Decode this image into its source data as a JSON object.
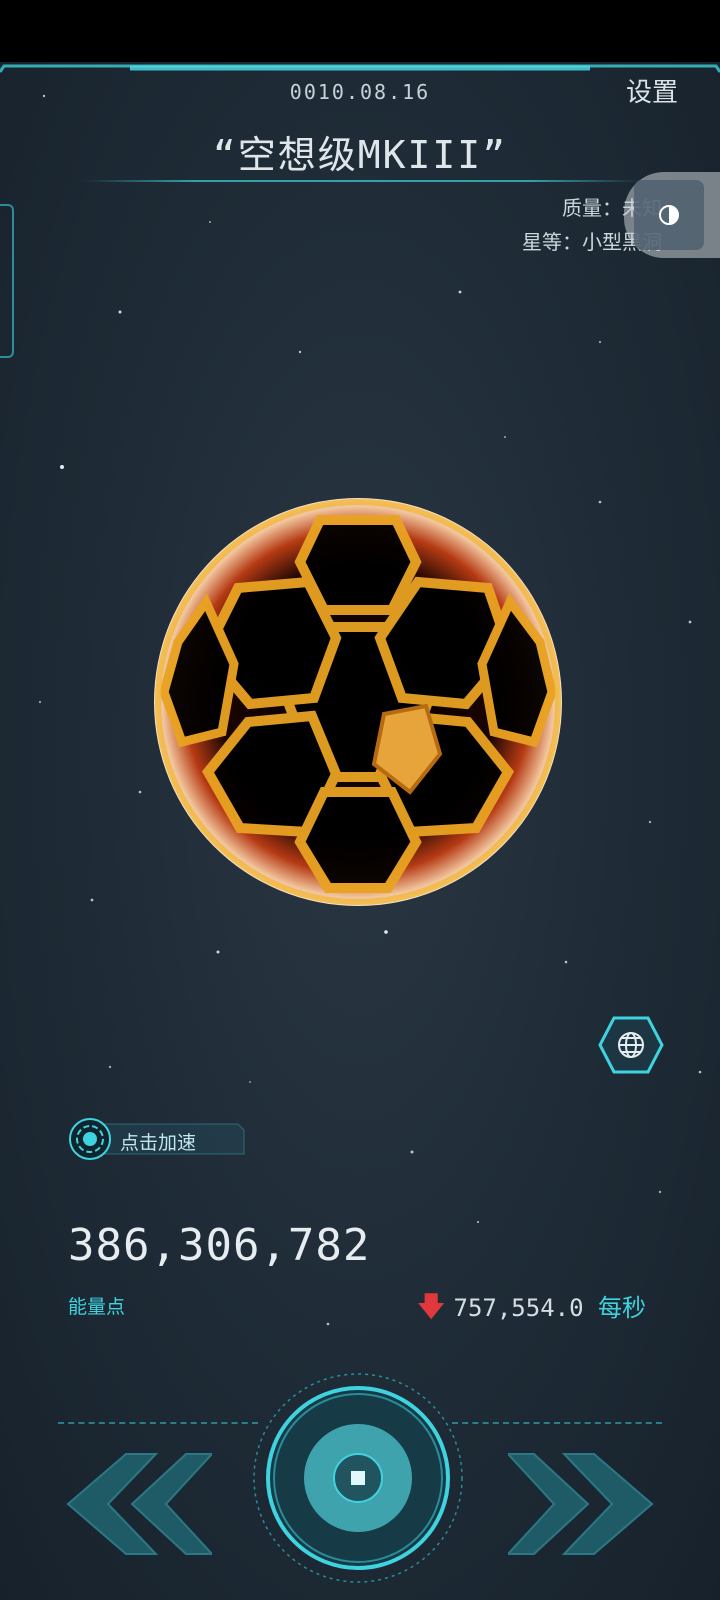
{
  "header": {
    "date": "0010.08.16",
    "settings_label": "设置",
    "title": "“空想级MKIII”"
  },
  "info": {
    "mass": "质量：未知",
    "grade": "星等：小型黑洞"
  },
  "accelerate": {
    "label": "点击加速"
  },
  "energy": {
    "value": "386,306,782",
    "label": "能量点"
  },
  "rate": {
    "direction": "down",
    "value": "757,554.0",
    "unit": "每秒"
  },
  "icons": {
    "globe": "globe-icon",
    "nav_left": "double-chevron-left-icon",
    "nav_right": "double-chevron-right-icon",
    "center": "core-button-icon",
    "accelerate": "target-icon",
    "arrow": "down-arrow-icon"
  },
  "colors": {
    "accent": "#3fd3e0",
    "down_arrow": "#e0383d",
    "sphere_frame": "#f0a020"
  }
}
